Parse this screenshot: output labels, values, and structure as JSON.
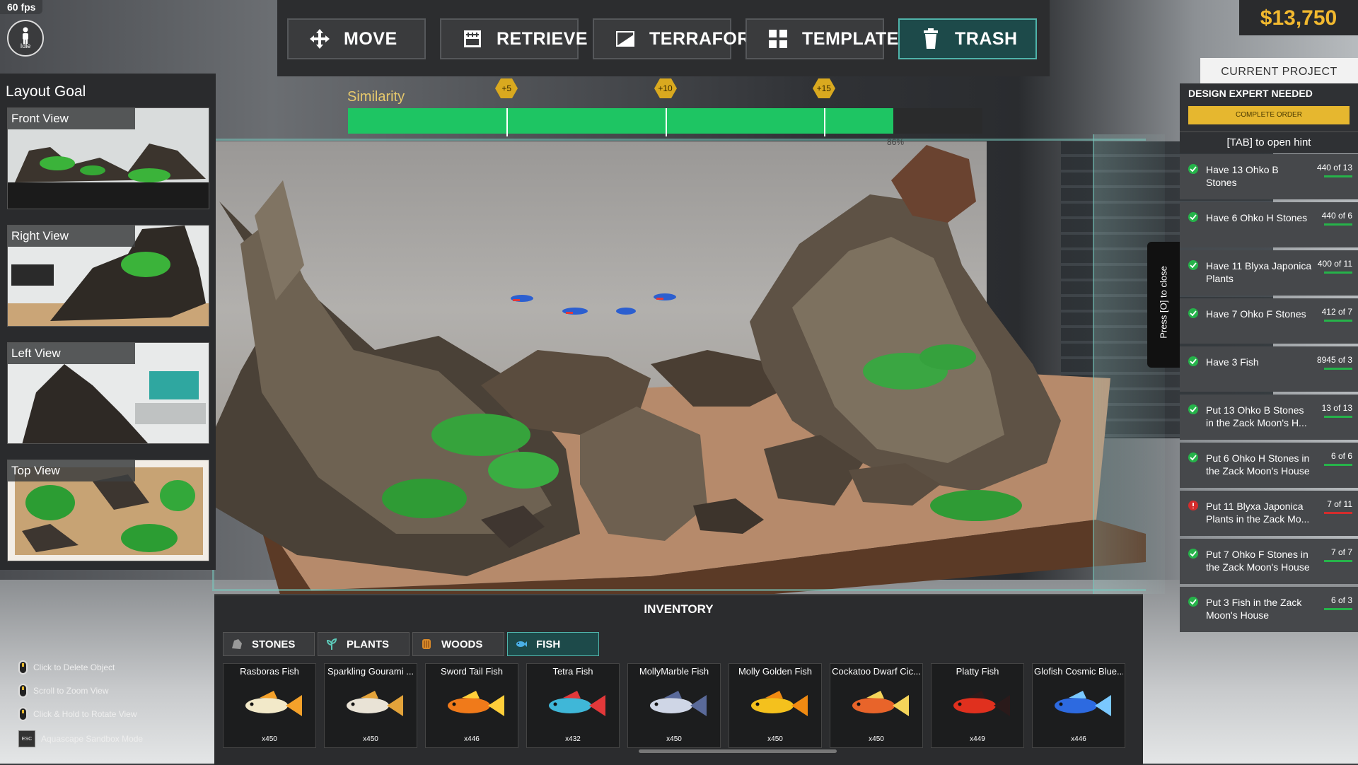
{
  "hud": {
    "fps": "60 fps",
    "status": "Idle",
    "money": "$13,750"
  },
  "toolbar": {
    "buttons": [
      {
        "label": "MOVE",
        "icon": "move-icon",
        "active": false
      },
      {
        "label": "RETRIEVE",
        "icon": "retrieve-icon",
        "active": false
      },
      {
        "label": "TERRAFORM",
        "icon": "terraform-icon",
        "active": false
      },
      {
        "label": "TEMPLATE",
        "icon": "template-icon",
        "active": false
      },
      {
        "label": "TRASH",
        "icon": "trash-icon",
        "active": true
      }
    ]
  },
  "layout_goal": {
    "title": "Layout Goal",
    "views": [
      "Front View",
      "Right View",
      "Left View",
      "Top View"
    ]
  },
  "similarity": {
    "label": "Similarity",
    "value_fraction": 0.86,
    "percent_text": "86%",
    "markers": [
      "+5",
      "+10",
      "+15"
    ],
    "marker_fractions": [
      0.25,
      0.5,
      0.75
    ]
  },
  "project": {
    "header": "CURRENT PROJECT",
    "expert": "DESIGN EXPERT NEEDED",
    "complete_button": "COMPLETE ORDER",
    "hint": "[TAB] to open hint",
    "close_tab": "Press [O] to close",
    "objectives": [
      {
        "text": "Have 13 Ohko B Stones",
        "count": "440 of 13",
        "done": true
      },
      {
        "text": "Have 6 Ohko H Stones",
        "count": "440 of 6",
        "done": true
      },
      {
        "text": "Have 11 Blyxa Japonica Plants",
        "count": "400 of 11",
        "done": true
      },
      {
        "text": "Have 7 Ohko F Stones",
        "count": "412 of 7",
        "done": true
      },
      {
        "text": "Have 3 Fish",
        "count": "8945 of 3",
        "done": true
      },
      {
        "text": "Put 13 Ohko B Stones in the Zack Moon's H...",
        "count": "13 of 13",
        "done": true
      },
      {
        "text": "Put 6 Ohko H Stones in the Zack Moon's House",
        "count": "6 of 6",
        "done": true
      },
      {
        "text": "Put 11 Blyxa Japonica Plants in the Zack Mo...",
        "count": "7 of 11",
        "done": false
      },
      {
        "text": "Put 7 Ohko F Stones in the Zack Moon's House",
        "count": "7 of 7",
        "done": true
      },
      {
        "text": "Put 3 Fish in the Zack Moon's House",
        "count": "6 of 3",
        "done": true
      }
    ]
  },
  "inventory": {
    "title": "INVENTORY",
    "tabs": [
      {
        "label": "STONES",
        "icon": "stone-icon",
        "active": false
      },
      {
        "label": "PLANTS",
        "icon": "plant-icon",
        "active": false
      },
      {
        "label": "WOODS",
        "icon": "wood-icon",
        "active": false
      },
      {
        "label": "FISH",
        "icon": "fish-icon",
        "active": true
      }
    ],
    "items": [
      {
        "name": "Rasboras Fish",
        "qty": "x450",
        "color": "#f2e9c9",
        "accent": "#f4a12a"
      },
      {
        "name": "Sparkling Gourami ...",
        "qty": "x450",
        "color": "#e9e3d6",
        "accent": "#e3a33a"
      },
      {
        "name": "Sword Tail Fish",
        "qty": "x446",
        "color": "#f07a1a",
        "accent": "#ffcf3a"
      },
      {
        "name": "Tetra Fish",
        "qty": "x432",
        "color": "#3fb7d8",
        "accent": "#e2383a"
      },
      {
        "name": "MollyMarble Fish",
        "qty": "x450",
        "color": "#cfd6e6",
        "accent": "#5a6a9a"
      },
      {
        "name": "Molly Golden Fish",
        "qty": "x450",
        "color": "#f4c11d",
        "accent": "#f08a12"
      },
      {
        "name": "Cockatoo Dwarf Cic...",
        "qty": "x450",
        "color": "#e8642a",
        "accent": "#f4d45a"
      },
      {
        "name": "Platty Fish",
        "qty": "x449",
        "color": "#e0301e",
        "accent": "#2a1a1a"
      },
      {
        "name": "Glofish Cosmic Blue...",
        "qty": "x446",
        "color": "#2d6ae0",
        "accent": "#7ac8ff"
      }
    ]
  },
  "controls": [
    {
      "text": "Click to Delete Object",
      "icon": "mouse-icon"
    },
    {
      "text": "Scroll to Zoom View",
      "icon": "mouse-icon"
    },
    {
      "text": "Click & Hold to Rotate View",
      "icon": "mouse-icon"
    },
    {
      "text": "Aquascape Sandbox Mode",
      "icon": "esc-key-icon",
      "key": "ESC"
    }
  ]
}
